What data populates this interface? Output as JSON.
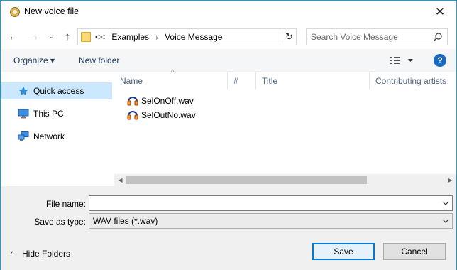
{
  "window": {
    "title": "New voice file",
    "close_glyph": "✕"
  },
  "navigation": {
    "back_glyph": "←",
    "forward_glyph": "→",
    "recent_glyph": "⌄",
    "up_glyph": "↑"
  },
  "address": {
    "overflow": "<<",
    "crumbs": [
      "Examples",
      "Voice Message"
    ],
    "separator": "›",
    "refresh_glyph": "↻"
  },
  "search": {
    "placeholder": "Search Voice Message"
  },
  "toolbar": {
    "organize_label": "Organize ▾",
    "new_folder_label": "New folder",
    "help_label": "?"
  },
  "nav_pane": {
    "items": [
      {
        "label": "Quick access",
        "icon": "star-icon",
        "selected": true
      },
      {
        "label": "This PC",
        "icon": "computer-icon",
        "selected": false
      },
      {
        "label": "Network",
        "icon": "network-icon",
        "selected": false
      }
    ]
  },
  "columns": {
    "name": "Name",
    "number": "#",
    "title": "Title",
    "contributing_artists": "Contributing artists",
    "sort_glyph": "^"
  },
  "files": [
    {
      "name": "SelOnOff.wav",
      "icon": "audio-file-icon"
    },
    {
      "name": "SelOutNo.wav",
      "icon": "audio-file-icon"
    }
  ],
  "form": {
    "file_name_label": "File name:",
    "file_name_value": "",
    "save_as_type_label": "Save as type:",
    "save_as_type_value": "WAV files (*.wav)"
  },
  "footer": {
    "hide_folders_label": "Hide Folders",
    "hide_folders_glyph": "^",
    "save_label": "Save",
    "cancel_label": "Cancel"
  },
  "colors": {
    "accent": "#0078d7",
    "window_border": "#1a9bd7",
    "selection": "#cce8ff",
    "toolbar_text": "#1e395b"
  }
}
